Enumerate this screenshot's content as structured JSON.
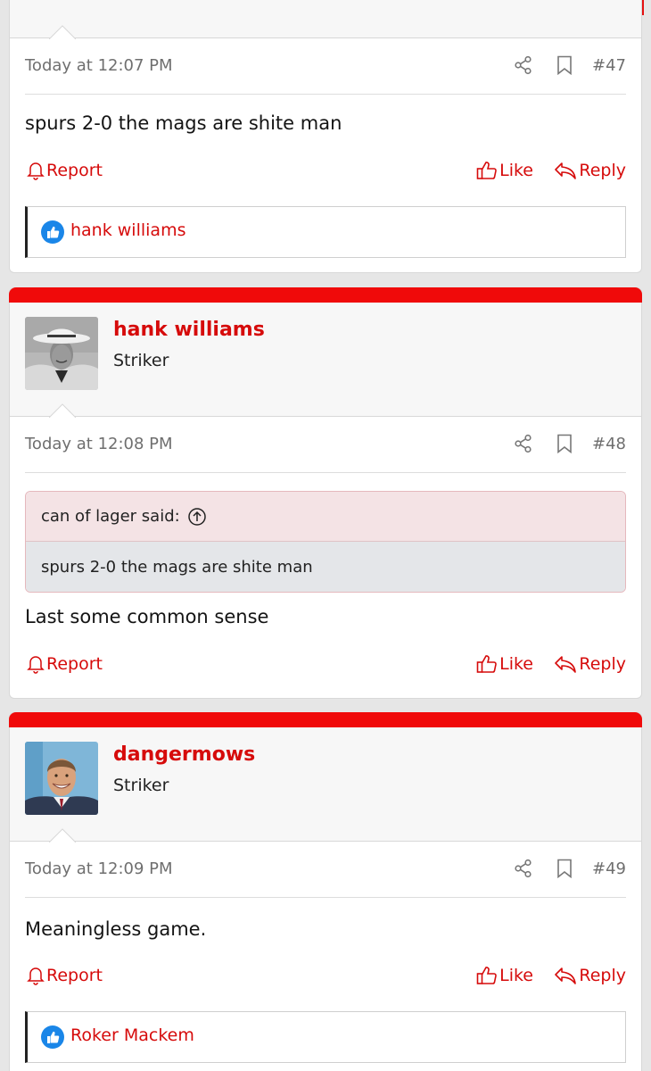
{
  "posts": [
    {
      "timestamp": "Today at 12:07 PM",
      "number": "#47",
      "text": "spurs 2-0 the mags are shite man",
      "report_label": "Report",
      "like_label": "Like",
      "reply_label": "Reply",
      "liked_by": "hank williams"
    },
    {
      "username": "hank williams",
      "user_title": "Striker",
      "timestamp": "Today at 12:08 PM",
      "number": "#48",
      "quote_author": "can of lager said:",
      "quote_text": "spurs 2-0 the mags are shite man",
      "text": "Last some common sense",
      "report_label": "Report",
      "like_label": "Like",
      "reply_label": "Reply"
    },
    {
      "username": "dangermows",
      "user_title": "Striker",
      "timestamp": "Today at 12:09 PM",
      "number": "#49",
      "text": "Meaningless game.",
      "report_label": "Report",
      "like_label": "Like",
      "reply_label": "Reply",
      "liked_by": "Roker Mackem"
    }
  ],
  "icons": {
    "share": "share-icon",
    "bookmark": "bookmark-icon",
    "report": "bell-icon",
    "like": "thumbs-up-icon",
    "reply": "reply-arrow-icon",
    "reaction": "like-reaction-icon",
    "quote_jump": "arrow-up-circle-icon"
  },
  "colors": {
    "accent": "#d60b0b",
    "bar": "#f00a0a",
    "reaction": "#1a86e8"
  }
}
